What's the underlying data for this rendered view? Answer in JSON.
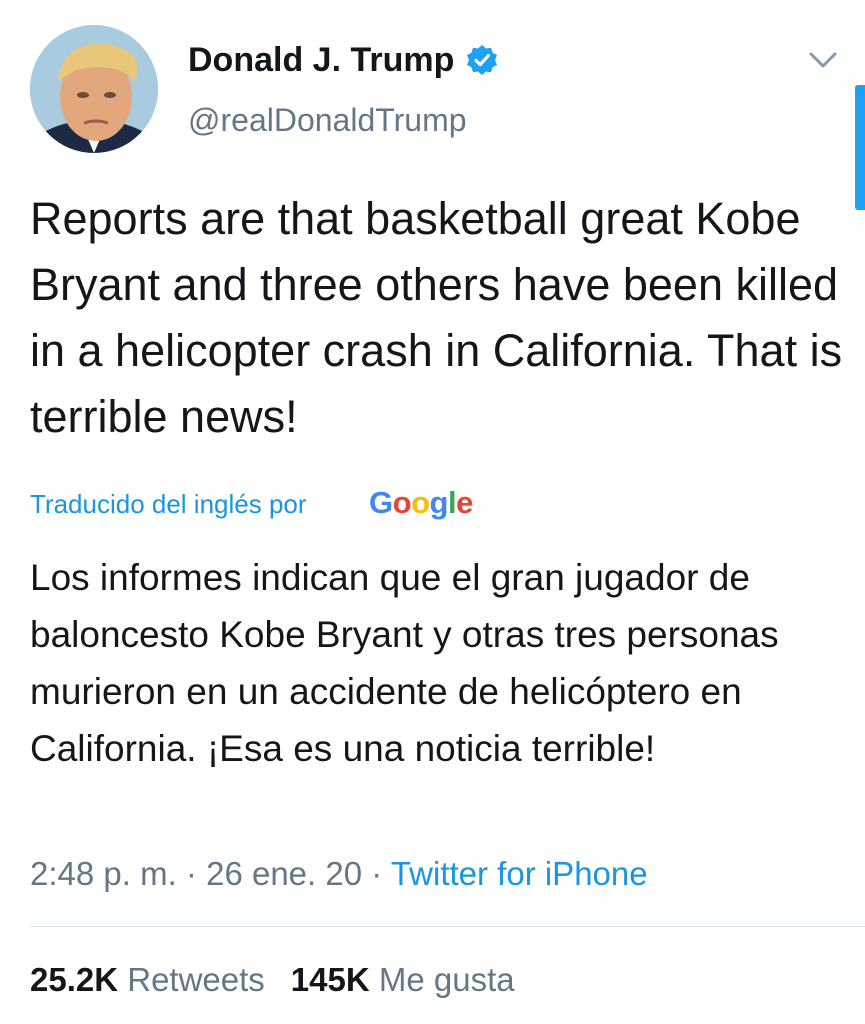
{
  "author": {
    "display_name": "Donald J. Trump",
    "handle": "@realDonaldTrump",
    "verified": true,
    "avatar_icon": "profile-photo"
  },
  "tweet": {
    "text": "Reports are that basketball great Kobe Bryant and three others have been killed in a helicopter crash in California. That is terrible news!",
    "translation_label": "Traducido del inglés por",
    "translation_provider": "Google",
    "translated_text": "Los informes indican que el gran jugador de baloncesto Kobe Bryant y otras tres personas murieron en un accidente de helicóptero en California. ¡Esa es una noticia terrible!",
    "time": "2:48 p. m.",
    "separator": "·",
    "date": "26 ene. 20",
    "source": "Twitter for iPhone"
  },
  "stats": {
    "retweets_count": "25.2K",
    "retweets_label": "Retweets",
    "likes_count": "145K",
    "likes_label": "Me gusta"
  },
  "colors": {
    "link_blue": "#1b95e0",
    "secondary_gray": "#657786",
    "primary_text": "#14171a",
    "google_blue": "#4285f4",
    "google_red": "#ea4335",
    "google_yellow": "#fbbc05",
    "google_green": "#34a853"
  },
  "icons": {
    "verified": "verified-badge-icon",
    "menu": "chevron-down-icon"
  }
}
